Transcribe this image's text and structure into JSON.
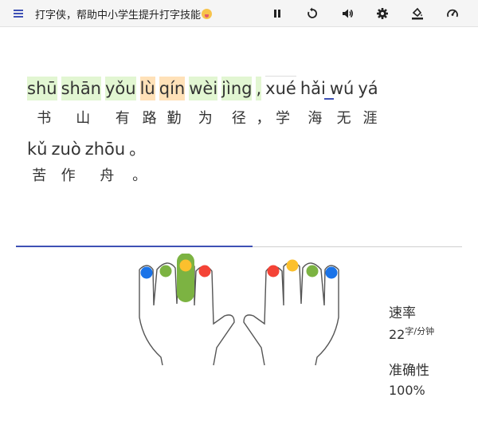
{
  "app": {
    "title": "打字侠，帮助中小学生提升打字技能"
  },
  "toolbar": {
    "buttons": [
      "pause-icon",
      "restart-icon",
      "volume-icon",
      "settings-icon",
      "paint-bucket-icon",
      "gauge-icon"
    ]
  },
  "exercise": {
    "line1": {
      "pinyin": [
        {
          "text": "shū",
          "state": "done"
        },
        {
          "text": "shān",
          "state": "done"
        },
        {
          "text": "yǒu",
          "state": "done"
        },
        {
          "text": "lù",
          "state": "error"
        },
        {
          "text": "qín",
          "state": "error"
        },
        {
          "text": "wèi",
          "state": "done"
        },
        {
          "text": "jìng",
          "state": "done"
        },
        {
          "text": ",",
          "state": "done"
        },
        {
          "text": "xué",
          "state": "current"
        },
        {
          "text": "hǎi",
          "state": "pending"
        },
        {
          "text": "wú",
          "state": "pending"
        },
        {
          "text": "yá",
          "state": "pending"
        }
      ],
      "hanzi": [
        "书",
        "山",
        "有",
        "路",
        "勤",
        "为",
        "径",
        "，",
        "学",
        "海",
        "无",
        "涯"
      ]
    },
    "line2": {
      "pinyin": [
        "kǔ",
        "zuò",
        "zhōu",
        "。"
      ],
      "hanzi": [
        "苦",
        "作",
        "舟",
        "。"
      ]
    }
  },
  "progress": {
    "fraction": 0.53
  },
  "keyboard_hint": {
    "highlighted_finger": "left-middle",
    "finger_colors": [
      "#1a73e8",
      "#7cb342",
      "#fbc02d",
      "#f44336",
      "#f44336",
      "#fbc02d",
      "#7cb342",
      "#1a73e8"
    ]
  },
  "stats": {
    "speed_label": "速率",
    "speed_value": "22",
    "speed_unit": "字/分钟",
    "accuracy_label": "准确性",
    "accuracy_value": "100%"
  }
}
